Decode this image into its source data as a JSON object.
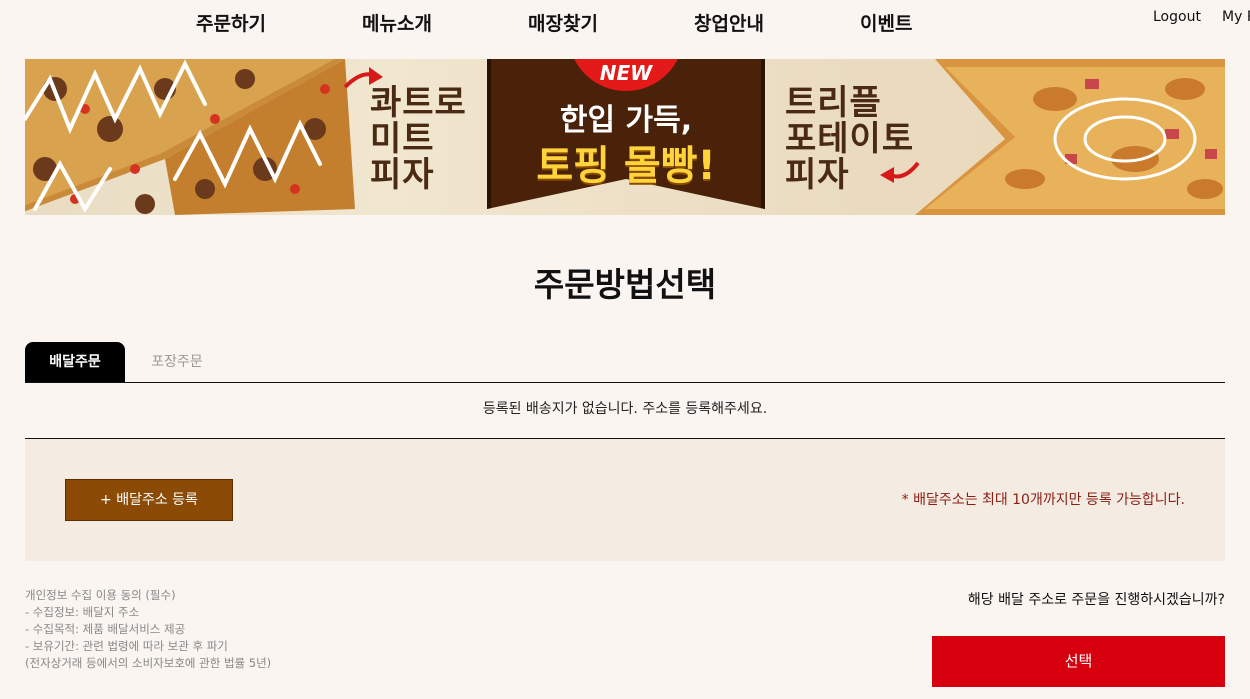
{
  "nav": {
    "items": [
      "주문하기",
      "메뉴소개",
      "매장찾기",
      "창업안내",
      "이벤트"
    ],
    "logout": "Logout",
    "mypage": "My P"
  },
  "banner": {
    "left_text": "콰트로\n미트\n피자",
    "right_text": "트리플\n포테이토\n피자",
    "badge": "NEW",
    "headline_line1": "한입 가득,",
    "headline_line2": "토핑 몰빵!"
  },
  "page_title": "주문방법선택",
  "tabs": [
    {
      "label": "배달주문",
      "active": true
    },
    {
      "label": "포장주문",
      "active": false
    }
  ],
  "empty_message": "등록된 배송지가 없습니다. 주소를 등록해주세요.",
  "address": {
    "add_button": "+ 배달주소 등록",
    "note": "* 배달주소는 최대 10개까지만 등록 가능합니다."
  },
  "privacy": {
    "lines": [
      "개인정보 수집 이용 동의 (필수)",
      "- 수집정보: 배달지 주소",
      "- 수집목적: 제품 배달서비스 제공",
      "- 보유기간: 관련 법령에 따라 보관 후 파기",
      "(전자상거래 등에서의 소비자보호에 관한 법률 5년)"
    ]
  },
  "confirm": {
    "question": "해당 배달 주소로 주문을 진행하시겠습니까?",
    "select_button": "선택"
  },
  "colors": {
    "accent_red": "#d6000f",
    "brown_button": "#8b4a06",
    "note_red": "#8b1f12",
    "background": "#faf5f1"
  }
}
